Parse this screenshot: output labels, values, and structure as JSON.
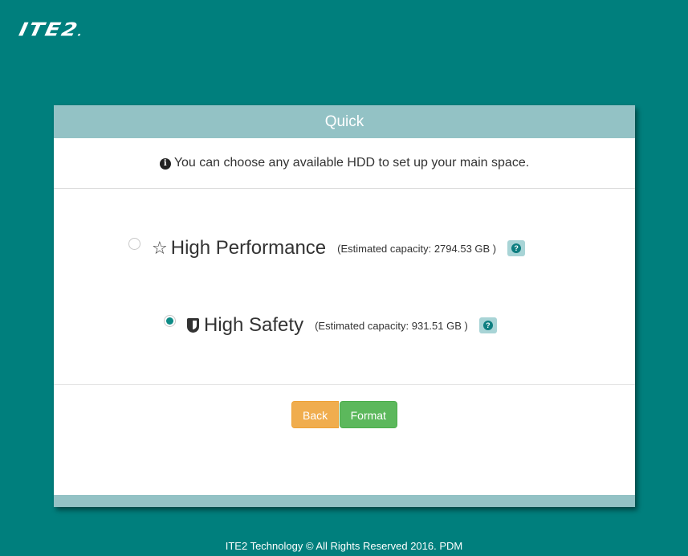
{
  "brand": {
    "logo_text": "ITE2",
    "logo_dot": "."
  },
  "panel": {
    "title": "Quick",
    "notice": "You can choose any available HDD to set up your main space.",
    "options": [
      {
        "label": "High Performance",
        "icon": "star-outline-icon",
        "capacity": "(Estimated capacity: 2794.53 GB )",
        "selected": false
      },
      {
        "label": "High Safety",
        "icon": "shield-icon",
        "capacity": "(Estimated capacity: 931.51 GB )",
        "selected": true
      }
    ],
    "buttons": {
      "back": "Back",
      "format": "Format"
    }
  },
  "colors": {
    "background": "#007f7d",
    "header": "#93c2c5",
    "back": "#f0ad4e",
    "format": "#5cb85c"
  },
  "footer": {
    "copyright": "ITE2 Technology © All Rights Reserved 2016. PDM"
  }
}
